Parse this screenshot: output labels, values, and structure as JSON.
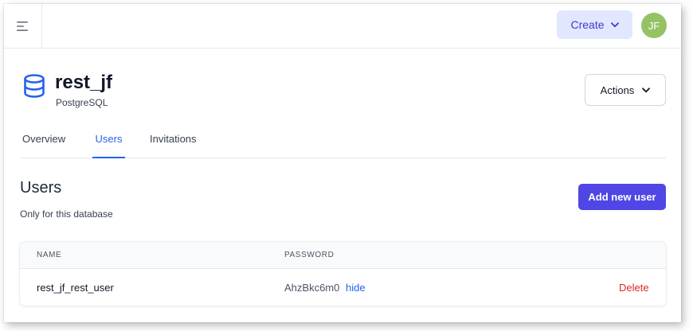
{
  "topbar": {
    "menu_icon": "menu-icon",
    "create_label": "Create",
    "avatar_initials": "JF"
  },
  "header": {
    "icon": "database-icon",
    "title": "rest_jf",
    "subtitle": "PostgreSQL",
    "actions_label": "Actions"
  },
  "tabs": [
    {
      "label": "Overview",
      "active": false
    },
    {
      "label": "Users",
      "active": true
    },
    {
      "label": "Invitations",
      "active": false
    }
  ],
  "users_section": {
    "title": "Users",
    "description": "Only for this database",
    "add_button_label": "Add new user"
  },
  "table": {
    "columns": [
      "NAME",
      "PASSWORD"
    ],
    "rows": [
      {
        "name": "rest_jf_rest_user",
        "password": "AhzBkc6m0",
        "toggle_label": "hide",
        "delete_label": "Delete"
      }
    ]
  },
  "colors": {
    "accent": "#4f46e5",
    "link": "#2563eb",
    "danger": "#dc2626",
    "avatar": "#94c265",
    "create_bg": "#e0e7ff"
  }
}
